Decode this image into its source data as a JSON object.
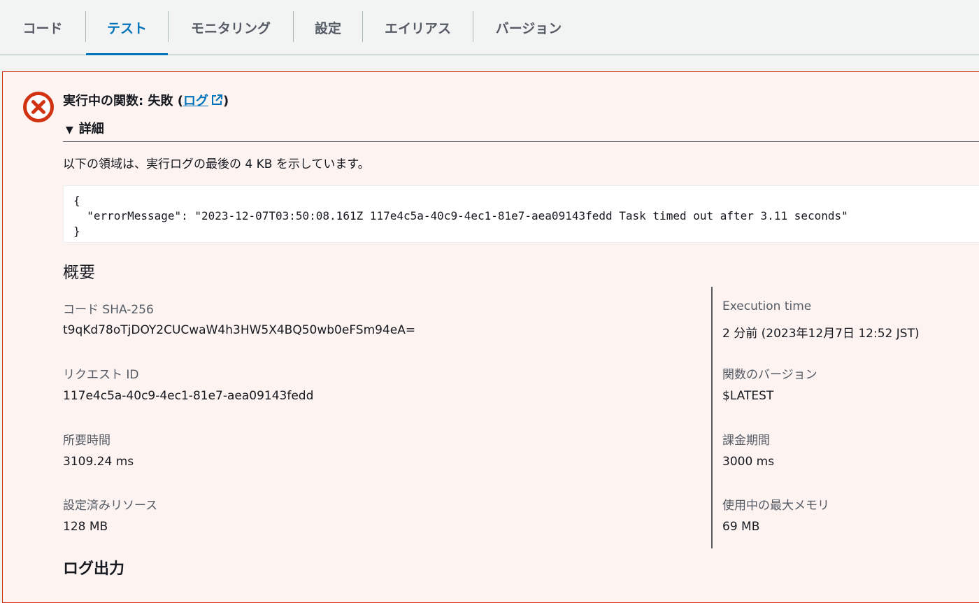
{
  "tabs": [
    {
      "label": "コード"
    },
    {
      "label": "テスト",
      "active": true
    },
    {
      "label": "モニタリング"
    },
    {
      "label": "設定"
    },
    {
      "label": "エイリアス"
    },
    {
      "label": "バージョン"
    }
  ],
  "alert": {
    "title_prefix": "実行中の関数: 失敗 (",
    "link_label": "ログ",
    "title_suffix": ")",
    "details_label": "詳細",
    "description": "以下の領域は、実行ログの最後の 4 KB を示しています。",
    "log_lines": [
      "{",
      "  \"errorMessage\": \"2023-12-07T03:50:08.161Z 117e4c5a-40c9-4ec1-81e7-aea09143fedd Task timed out after 3.11 seconds\"",
      "}"
    ],
    "status_color": "#d13212"
  },
  "summary": {
    "heading": "概要",
    "left": [
      {
        "label": "コード SHA-256",
        "value": "t9qKd78oTjDOY2CUCwaW4h3HW5X4BQ50wb0eFSm94eA="
      },
      {
        "label": "リクエスト ID",
        "value": "117e4c5a-40c9-4ec1-81e7-aea09143fedd"
      },
      {
        "label": "所要時間",
        "value": "3109.24 ms"
      },
      {
        "label": "設定済みリソース",
        "value": "128 MB"
      }
    ],
    "right": [
      {
        "label": "Execution time",
        "value": "2 分前 (2023年12月7日 12:52 JST)"
      },
      {
        "label": "関数のバージョン",
        "value": "$LATEST"
      },
      {
        "label": "課金期間",
        "value": "3000 ms"
      },
      {
        "label": "使用中の最大メモリ",
        "value": "69 MB"
      }
    ]
  },
  "log_output_heading": "ログ出力",
  "icons": {
    "error": "error-x-circle-icon",
    "external": "external-link-icon",
    "toggle": "caret-down-icon"
  }
}
